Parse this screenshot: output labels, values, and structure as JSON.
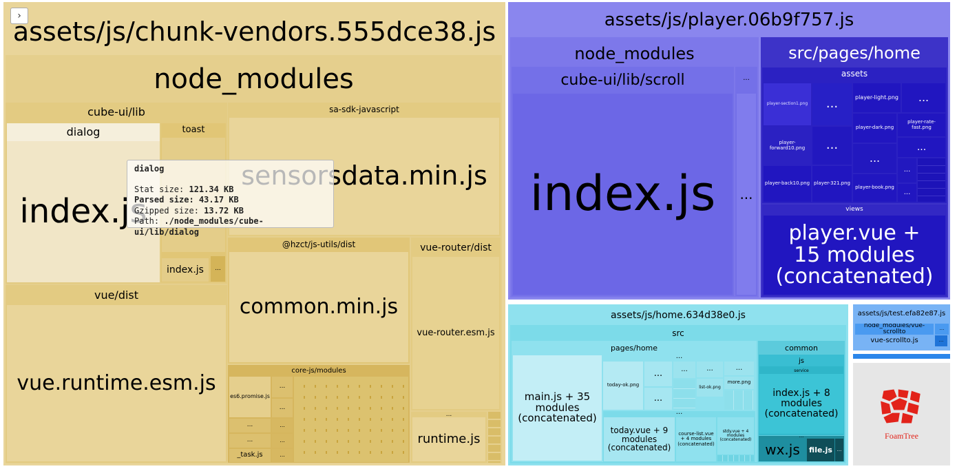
{
  "toggle": {
    "icon": "›"
  },
  "vendors": {
    "chunk_title": "assets/js/chunk-vendors.555dce38.js",
    "node_modules_label": "node_modules",
    "cube_ui": {
      "label": "cube-ui/lib",
      "dialog_label": "dialog",
      "dialog_index": "index.js",
      "toast_label": "toast",
      "toast_index": "index.js",
      "more": "..."
    },
    "vue_dist": {
      "label": "vue/dist",
      "file": "vue.runtime.esm.js"
    },
    "sa_sdk": {
      "label": "sa-sdk-javascript",
      "file": "sensorsdata.min.js"
    },
    "js_utils": {
      "label": "@hzct/js-utils/dist",
      "file": "common.min.js"
    },
    "vue_router": {
      "label": "vue-router/dist",
      "file": "vue-router.esm.js"
    },
    "core_js": {
      "label": "core-js/modules",
      "es6_promise": "es6.promise.js",
      "task": "_task.js",
      "more": "..."
    },
    "runtime": {
      "file": "runtime.js",
      "more": "..."
    }
  },
  "player": {
    "chunk_title": "assets/js/player.06b9f757.js",
    "node_modules_label": "node_modules",
    "scroll_label": "cube-ui/lib/scroll",
    "index_file": "index.js",
    "more": "...",
    "home_label": "src/pages/home",
    "assets_label": "assets",
    "assets_files": [
      "player-section1.png",
      "player-light.png",
      "player-rate-fast.png",
      "player-dark.png",
      "player-forward10.png",
      "player-back10.png",
      "player-321.png",
      "player-book.png"
    ],
    "views_label": "views",
    "views_file": "player.vue + 15 modules (concatenated)"
  },
  "home": {
    "chunk_title": "assets/js/home.634d38e0.js",
    "src_label": "src",
    "pages_home_label": "pages/home",
    "main_file": "main.js + 35 modules (concatenated)",
    "today_ok": "today-ok.png",
    "list_ok": "list-ok.png",
    "more_png": "more.png",
    "today_vue": "today.vue + 9 modules (concatenated)",
    "course_list": "course-list.vue + 4 modules (concatenated)",
    "stdy_vue": "stdy.vue + 4 modules (concatenated)",
    "common_label": "common",
    "js_label": "js",
    "service_label": "service",
    "service_file": "index.js + 8 modules (concatenated)",
    "wx_file": "wx.js",
    "file_file": "file.js",
    "more": "..."
  },
  "test": {
    "chunk_title": "assets/js/test.efa82e87.js",
    "nm_label": "node_modules/vue-scrollto",
    "file": "vue-scrollto.js",
    "more": "..."
  },
  "foamtree": {
    "label": "FoamTree"
  },
  "tooltip": {
    "name": "dialog",
    "stat_label": "Stat size:",
    "stat_value": "121.34 KB",
    "parsed_label": "Parsed size:",
    "parsed_value": "43.17 KB",
    "gzip_label": "Gzipped size:",
    "gzip_value": "13.72 KB",
    "path_label": "Path:",
    "path_value": "./node_modules/cube-ui/lib/dialog"
  },
  "colors": {
    "vendors": "#e9d59a",
    "player": "#8a86ee",
    "home": "#8fe1ee",
    "test": "#78b3f5",
    "foamtree": "#e6e6e6",
    "foamtree_red": "#e2231a"
  }
}
